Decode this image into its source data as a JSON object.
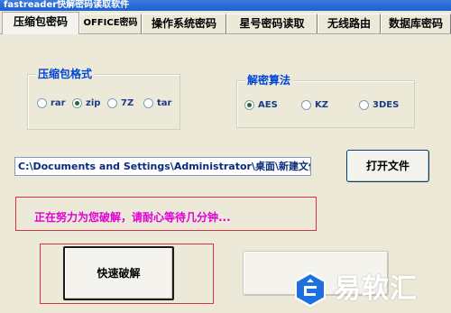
{
  "window": {
    "title": "fastreader快解密码读取软件"
  },
  "tabs": [
    {
      "label": "压缩包密码",
      "active": true
    },
    {
      "label": "OFFICE密码",
      "active": false
    },
    {
      "label": "操作系统密码",
      "active": false
    },
    {
      "label": "星号密码读取",
      "active": false
    },
    {
      "label": "无线路由",
      "active": false
    },
    {
      "label": "数据库密码",
      "active": false
    }
  ],
  "format_group": {
    "title": "压缩包格式",
    "options": [
      {
        "label": "rar",
        "selected": false
      },
      {
        "label": "zip",
        "selected": true
      },
      {
        "label": "7Z",
        "selected": false
      },
      {
        "label": "tar",
        "selected": false
      }
    ]
  },
  "algorithm_group": {
    "title": "解密算法",
    "options": [
      {
        "label": "AES",
        "selected": true
      },
      {
        "label": "KZ",
        "selected": false
      },
      {
        "label": "3DES",
        "selected": false
      }
    ]
  },
  "path": {
    "value": "C:\\Documents and Settings\\Administrator\\桌面\\新建文件夹"
  },
  "buttons": {
    "open_file": "打开文件",
    "quick_crack": "快速破解"
  },
  "status": {
    "text": "正在努力为您破解，请耐心等待几分钟..."
  },
  "watermark": {
    "text": "易软汇"
  },
  "colors": {
    "accent_blue": "#0046d5",
    "status_magenta": "#e000d8",
    "frame_red": "#e03040",
    "window_bg": "#ece9d8"
  }
}
